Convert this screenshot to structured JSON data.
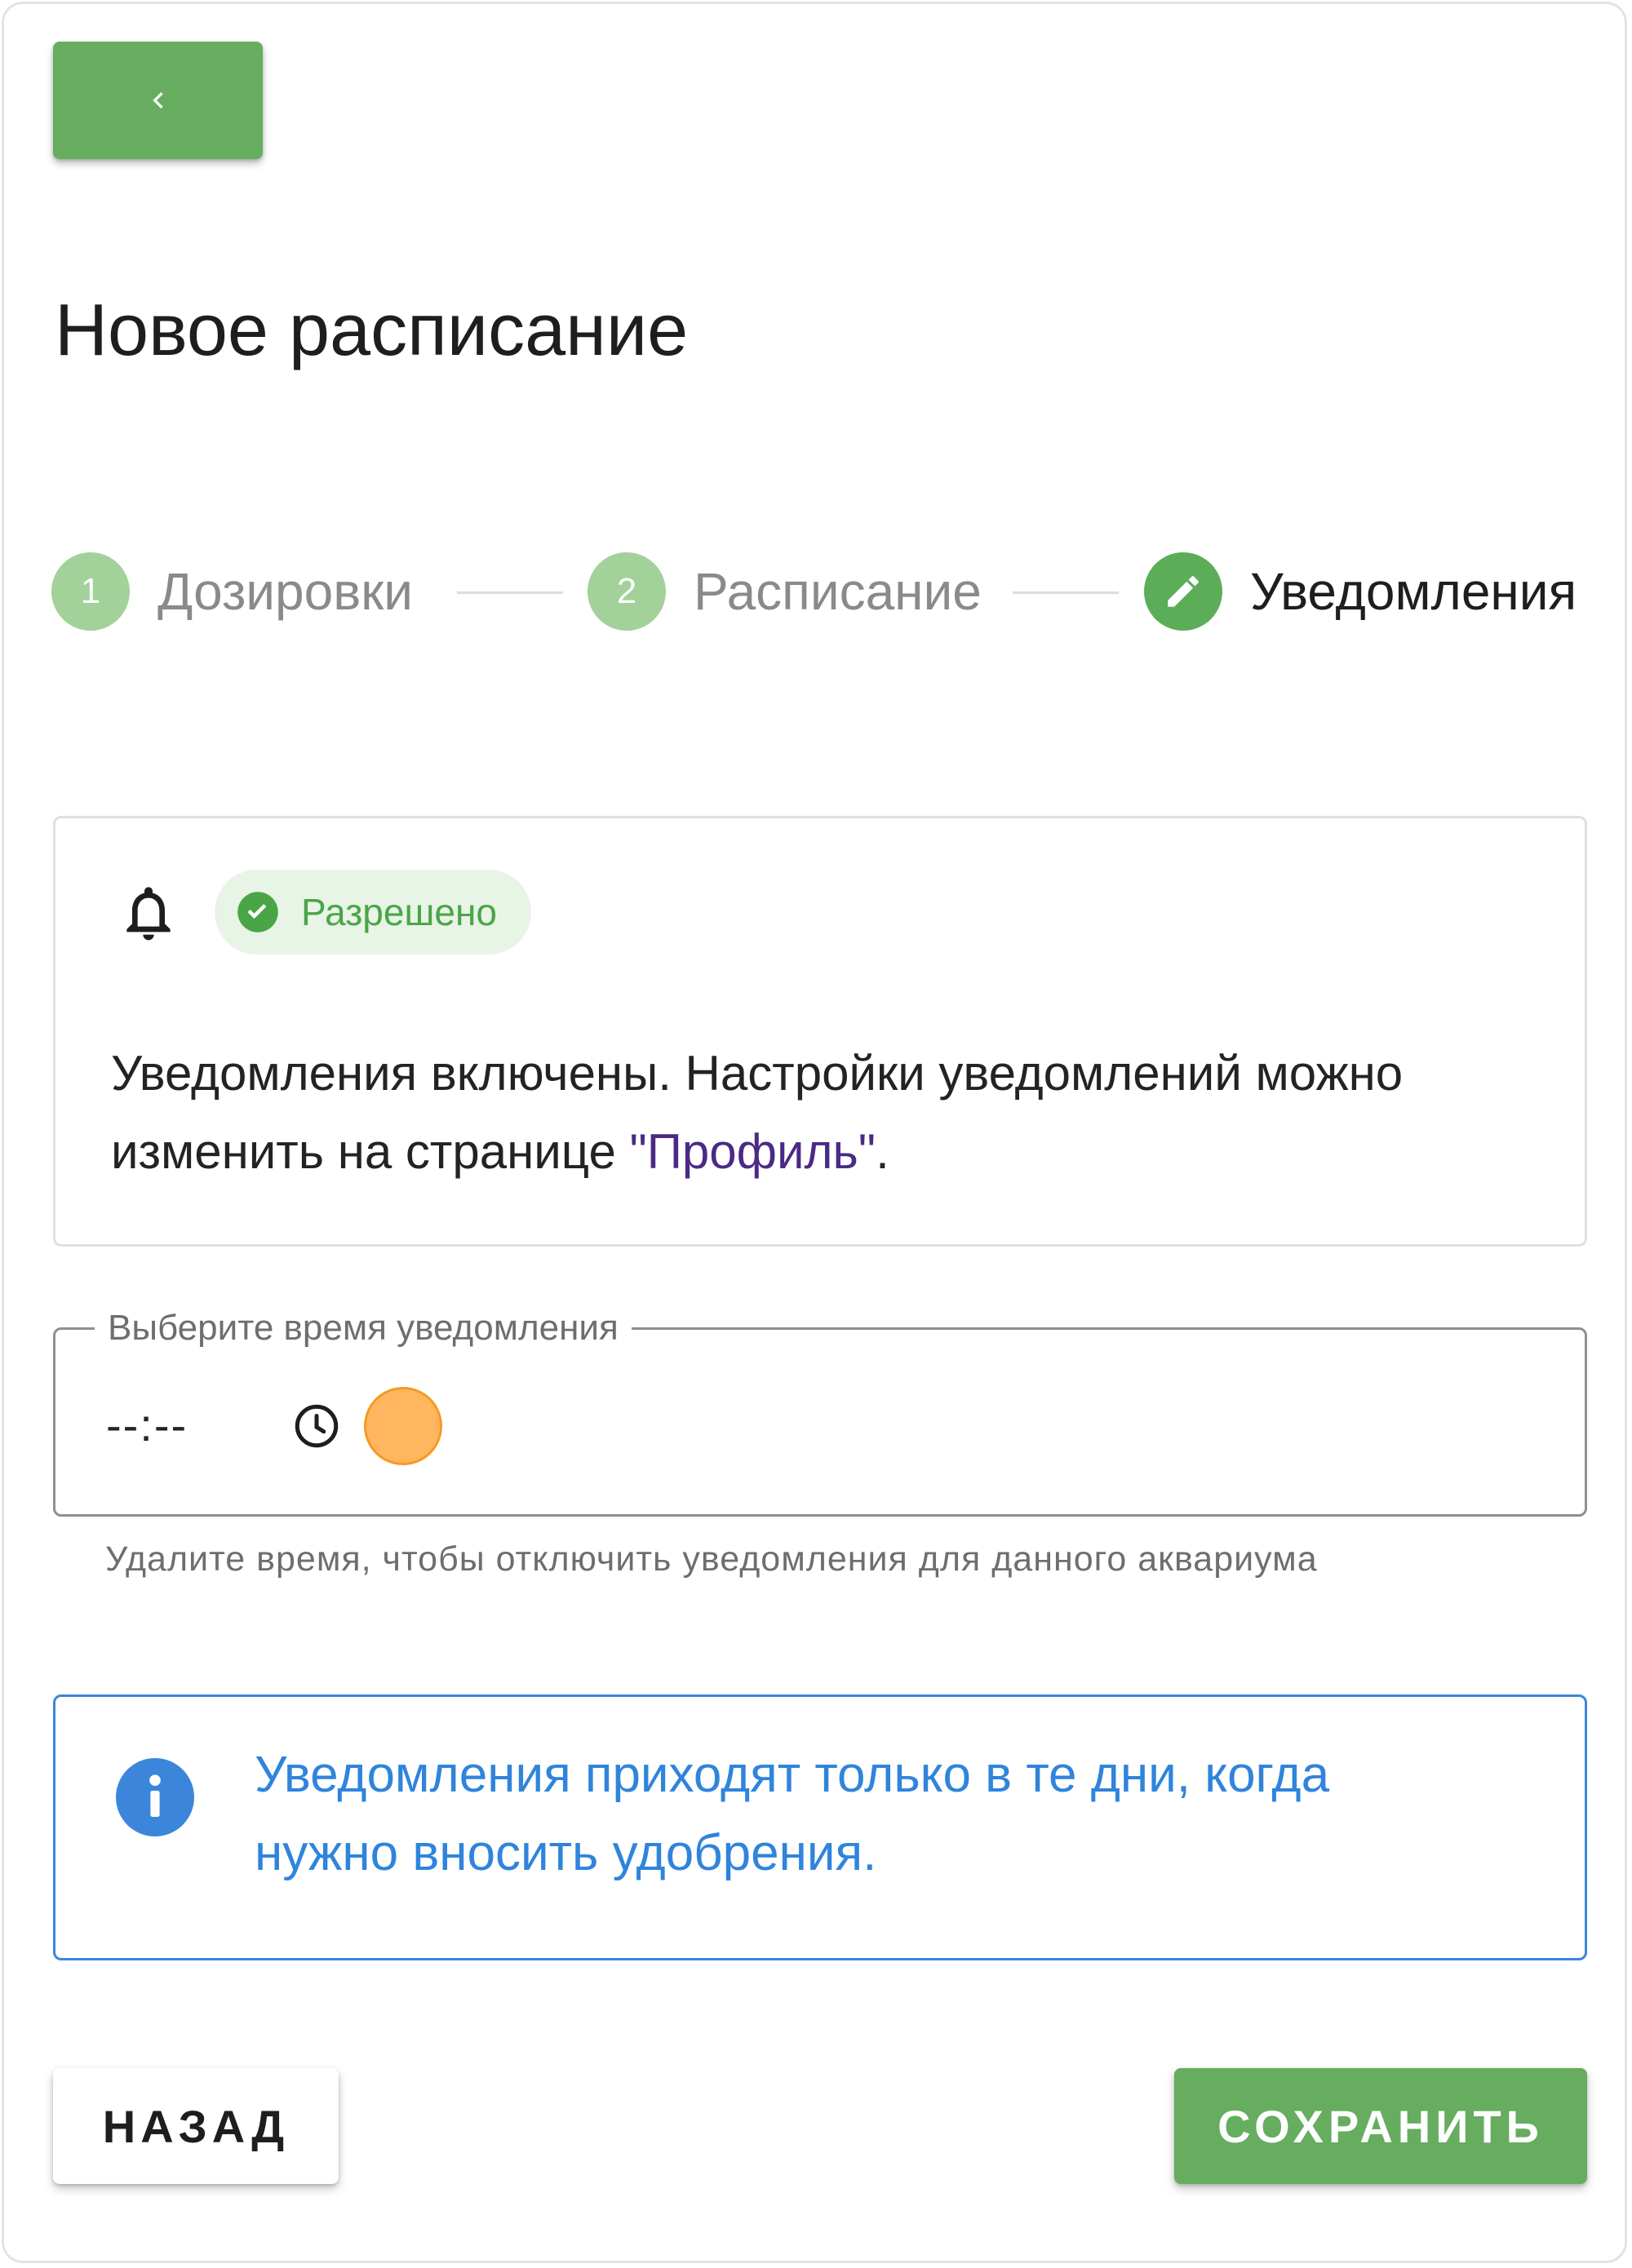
{
  "header": {
    "back_icon": "chevron-left-icon",
    "title": "Новое расписание"
  },
  "stepper": {
    "steps": [
      {
        "number": "1",
        "label": "Дозировки",
        "state": "done"
      },
      {
        "number": "2",
        "label": "Расписание",
        "state": "done"
      },
      {
        "number": "",
        "label": "Уведомления",
        "state": "active",
        "icon": "pencil-icon"
      }
    ]
  },
  "status_card": {
    "icon": "bell-icon",
    "badge_icon": "check-circle-icon",
    "badge_label": "Разрешено",
    "text_before": "Уведомления включены. Настройки уведомлений можно изменить на странице ",
    "link_text": "\"Профиль\"",
    "text_after": "."
  },
  "time_field": {
    "label": "Выберите время уведомления",
    "value": "--:--",
    "icon": "clock-icon",
    "helper": "Удалите время, чтобы отключить уведомления для данного аквариума"
  },
  "info_card": {
    "icon": "info-icon",
    "text": "Уведомления приходят только в те дни, когда нужно вносить удобрения."
  },
  "actions": {
    "back_label": "НАЗАД",
    "save_label": "СОХРАНИТЬ"
  },
  "colors": {
    "primary_green": "#66ad5f",
    "step_done": "#a2d19a",
    "step_active": "#5cad58",
    "info_blue": "#2f84dc",
    "link_purple": "#4b2a86",
    "badge_bg": "#e8f4e6"
  }
}
